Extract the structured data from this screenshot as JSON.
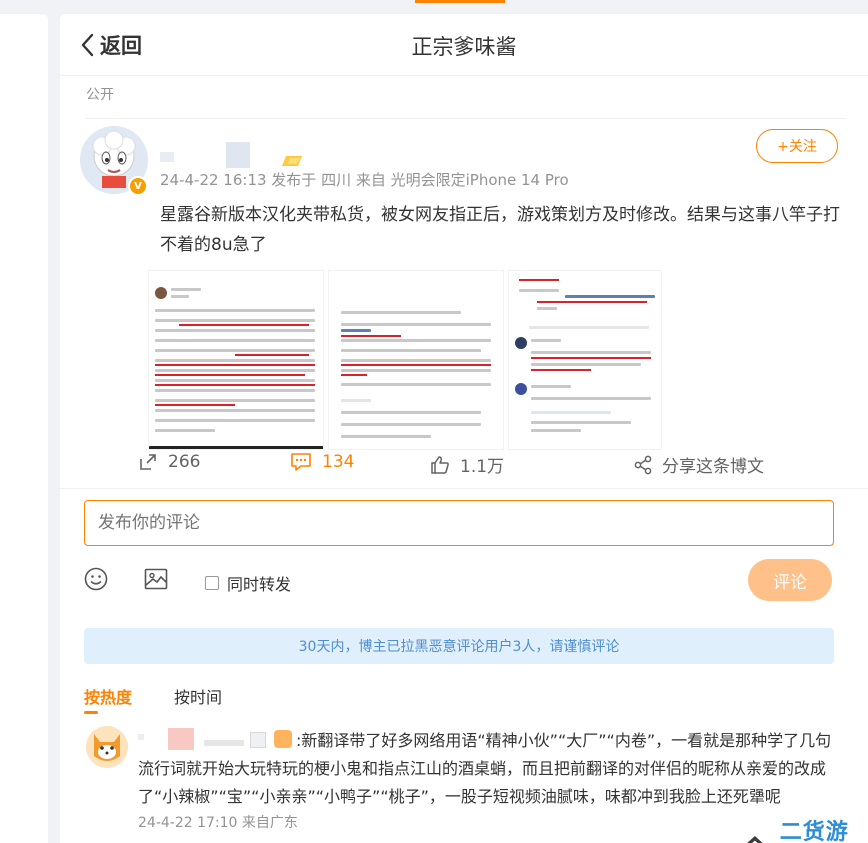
{
  "header": {
    "back_label": "返回",
    "title": "正宗爹味酱"
  },
  "post": {
    "visibility": "公开",
    "meta": "24-4-22 16:13  发布于 四川  来自 光明会限定iPhone 14 Pro",
    "follow_label": "+关注",
    "text": "星露谷新版本汉化夹带私货，被女网友指正后，游戏策划方及时修改。结果与这事八竿子打不着的8u急了",
    "stats": {
      "reposts": "266",
      "comments": "134",
      "likes": "1.1万",
      "share_label": "分享这条博文"
    }
  },
  "compose": {
    "placeholder": "发布你的评论",
    "repost_label": "同时转发",
    "submit_label": "评论"
  },
  "notice": "30天内，博主已拉黑恶意评论用户3人，请谨慎评论",
  "sort": {
    "hot": "按热度",
    "time": "按时间"
  },
  "comments": [
    {
      "text": ":新翻译带了好多网络用语“精神小伙”“大厂”“内卷”，一看就是那种学了几句流行词就开始大玩特玩的梗小鬼和指点江山的酒桌蛸，而且把前翻译的对伴侣的昵称从亲爱的改成了“小辣椒”“宝”“小亲亲”“小鸭子”“桃子”，一股子短视频油腻味，味都冲到我脸上还死犟呢",
      "meta": "24-4-22 17:10  来自广东"
    }
  ],
  "watermark": "二货游戏园",
  "colors": {
    "accent": "#ff8200",
    "notice_bg": "#e0effc",
    "notice_text": "#4e8ed1"
  }
}
